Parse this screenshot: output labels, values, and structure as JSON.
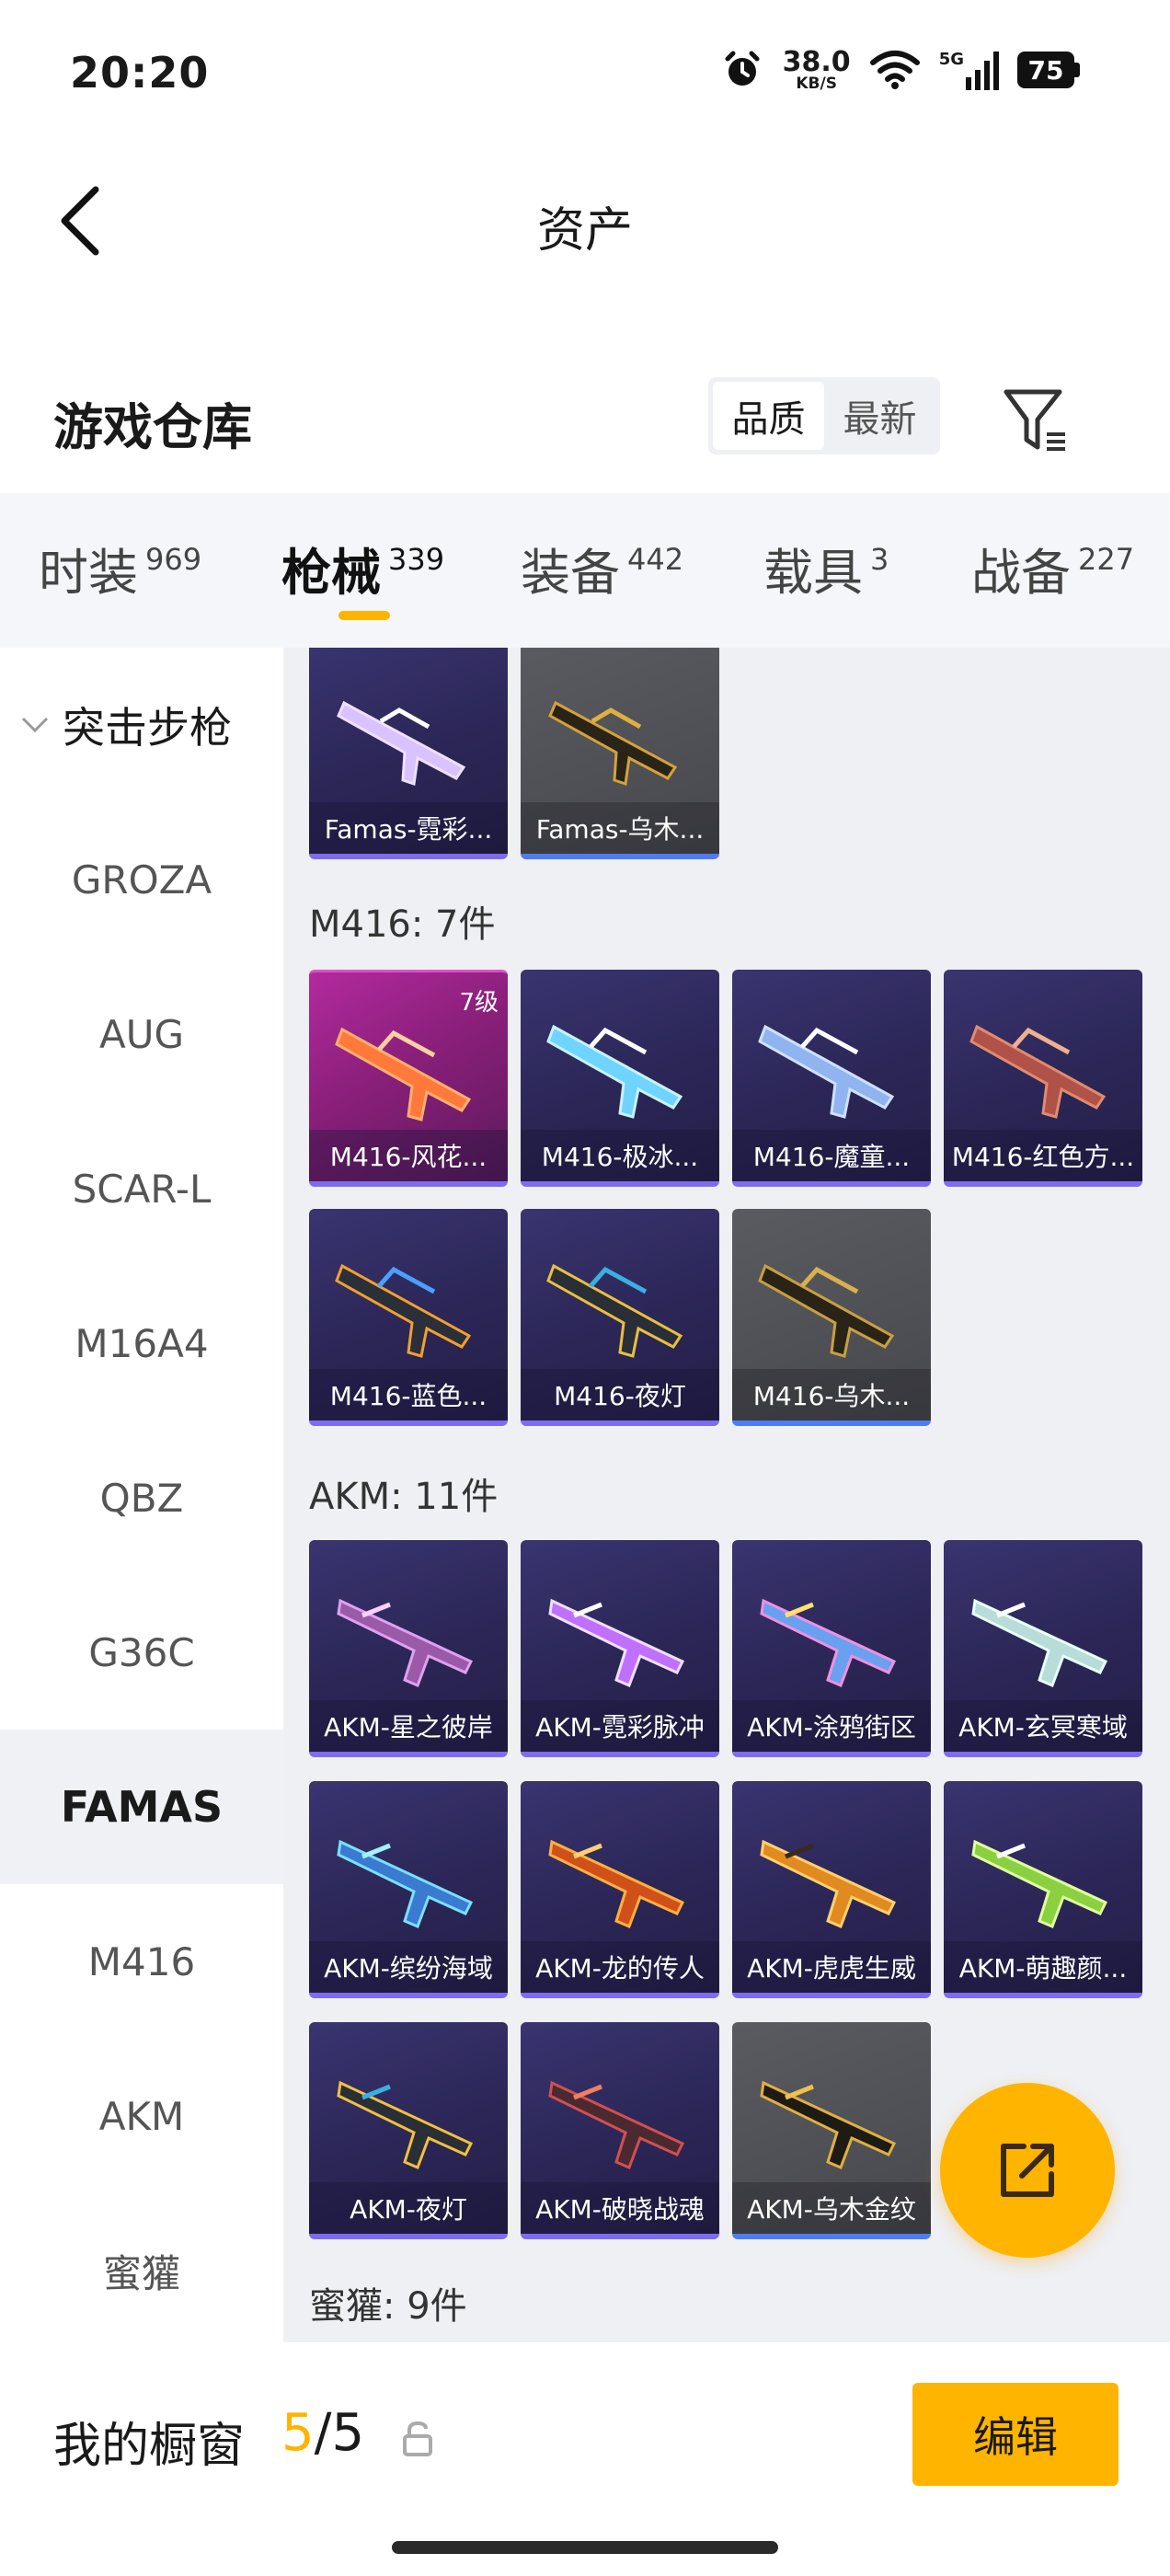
{
  "status_bar": {
    "time": "20:20",
    "net_speed": "38.0",
    "net_unit": "KB/S",
    "network": "5G",
    "battery": "75"
  },
  "nav": {
    "title": "资产"
  },
  "section": {
    "title": "游戏仓库",
    "sort_options": [
      "品质",
      "最新"
    ]
  },
  "tabs": [
    {
      "label": "时装",
      "count": "969"
    },
    {
      "label": "枪械",
      "count": "339"
    },
    {
      "label": "装备",
      "count": "442"
    },
    {
      "label": "载具",
      "count": "3"
    },
    {
      "label": "战备",
      "count": "227"
    }
  ],
  "sidebar": {
    "group": "突击步枪",
    "items": [
      "GROZA",
      "AUG",
      "SCAR-L",
      "M16A4",
      "QBZ",
      "G36C",
      "FAMAS",
      "M416",
      "AKM",
      "蜜獾"
    ],
    "active": "FAMAS"
  },
  "groups": {
    "famas": {
      "items": [
        {
          "label": "Famas-霓彩...",
          "style": "purple"
        },
        {
          "label": "Famas-乌木...",
          "style": "grey"
        }
      ]
    },
    "m416": {
      "title": "M416: 7件",
      "items": [
        {
          "label": "M416-风花...",
          "style": "pink",
          "level": "7级"
        },
        {
          "label": "M416-极冰...",
          "style": "purple"
        },
        {
          "label": "M416-魔童...",
          "style": "purple"
        },
        {
          "label": "M416-红色方...",
          "style": "purple"
        },
        {
          "label": "M416-蓝色...",
          "style": "purple"
        },
        {
          "label": "M416-夜灯",
          "style": "purple"
        },
        {
          "label": "M416-乌木...",
          "style": "grey"
        }
      ]
    },
    "akm": {
      "title": "AKM: 11件",
      "items": [
        {
          "label": "AKM-星之彼岸",
          "style": "purple"
        },
        {
          "label": "AKM-霓彩脉冲",
          "style": "purple"
        },
        {
          "label": "AKM-涂鸦街区",
          "style": "purple"
        },
        {
          "label": "AKM-玄冥寒域",
          "style": "purple"
        },
        {
          "label": "AKM-缤纷海域",
          "style": "purple"
        },
        {
          "label": "AKM-龙的传人",
          "style": "purple"
        },
        {
          "label": "AKM-虎虎生威",
          "style": "purple"
        },
        {
          "label": "AKM-萌趣颜...",
          "style": "purple"
        },
        {
          "label": "AKM-夜灯",
          "style": "purple"
        },
        {
          "label": "AKM-破晓战魂",
          "style": "purple"
        },
        {
          "label": "AKM-乌木金纹",
          "style": "grey"
        }
      ]
    },
    "honey_badger": {
      "title": "蜜獾: 9件"
    }
  },
  "bottom": {
    "showcase_label": "我的橱窗",
    "showcase_current": "5",
    "showcase_sep": "/",
    "showcase_total": "5",
    "edit_label": "编辑"
  },
  "colors": {
    "accent": "#ffb400",
    "card_purple": "#2b2656",
    "card_grey": "#47484d",
    "card_pink": "#b32a9e"
  }
}
